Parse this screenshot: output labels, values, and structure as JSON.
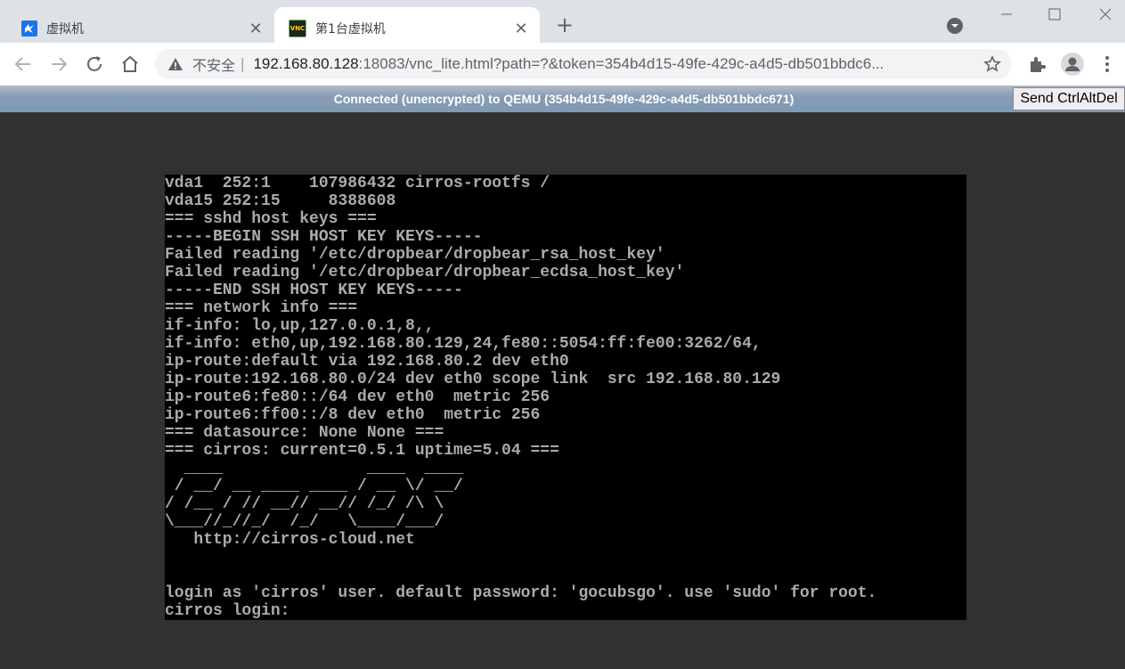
{
  "browser": {
    "tabs": [
      {
        "title": "虚拟机",
        "favicon": "app-icon",
        "active": false
      },
      {
        "title": "第1台虚拟机",
        "favicon": "vnc-icon",
        "active": true
      }
    ],
    "new_tab_label": "+",
    "address": {
      "security_label": "不安全",
      "separator": "|",
      "host": "192.168.80.128",
      "rest": ":18083/vnc_lite.html?path=?&token=354b4d15-49fe-429c-a4d5-db501bbdc6..."
    },
    "favicon_vnc_text": "VNC"
  },
  "vnc": {
    "status": "Connected (unencrypted) to QEMU (354b4d15-49fe-429c-a4d5-db501bbdc671)",
    "ctrl_alt_del_label": "Send CtrlAltDel",
    "console_lines": [
      "vda1  252:1    107986432 cirros-rootfs /",
      "vda15 252:15     8388608",
      "=== sshd host keys ===",
      "-----BEGIN SSH HOST KEY KEYS-----",
      "Failed reading '/etc/dropbear/dropbear_rsa_host_key'",
      "Failed reading '/etc/dropbear/dropbear_ecdsa_host_key'",
      "-----END SSH HOST KEY KEYS-----",
      "=== network info ===",
      "if-info: lo,up,127.0.0.1,8,,",
      "if-info: eth0,up,192.168.80.129,24,fe80::5054:ff:fe00:3262/64,",
      "ip-route:default via 192.168.80.2 dev eth0",
      "ip-route:192.168.80.0/24 dev eth0 scope link  src 192.168.80.129",
      "ip-route6:fe80::/64 dev eth0  metric 256",
      "ip-route6:ff00::/8 dev eth0  metric 256",
      "=== datasource: None None ===",
      "=== cirros: current=0.5.1 uptime=5.04 ===",
      "  ____               ____  ____",
      " / __/ __ ____ ____ / __ \\/ __/",
      "/ /__ / // __// __// /_/ /\\ \\",
      "\\___//_//_/  /_/   \\____/___/",
      "   http://cirros-cloud.net",
      "",
      "",
      "login as 'cirros' user. default password: 'gocubsgo'. use 'sudo' for root.",
      "cirros login:"
    ]
  },
  "colors": {
    "tabbar": "#dee1e6",
    "status_gradient": "#899cb3",
    "background": "#313131",
    "console_text": "#ababab"
  }
}
